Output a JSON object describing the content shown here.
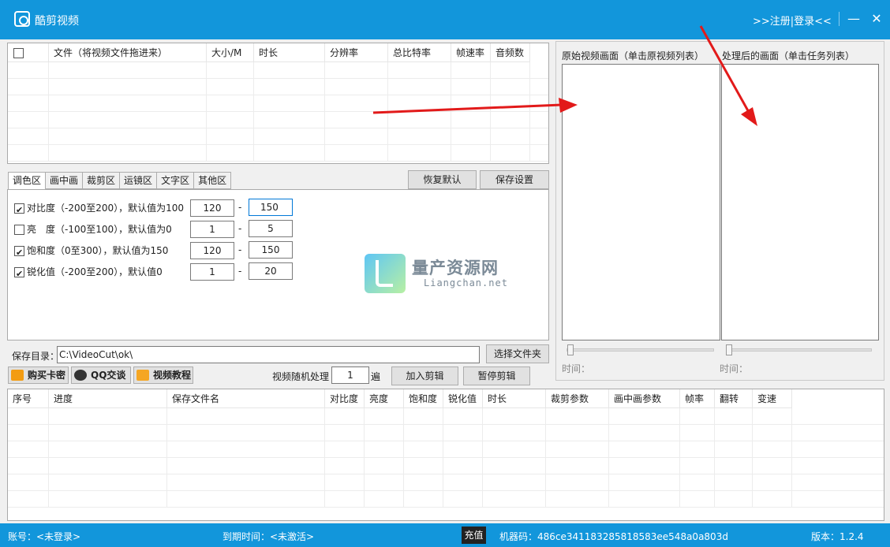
{
  "titlebar": {
    "title": "酷剪视频",
    "register_login": ">>注册|登录<<",
    "minimize": "—",
    "close": "✕"
  },
  "file_table": {
    "columns": [
      "文件（将视频文件拖进来）",
      "大小/M",
      "时长",
      "分辨率",
      "总比特率",
      "帧速率",
      "音频数"
    ]
  },
  "tabs": [
    "调色区",
    "画中画",
    "裁剪区",
    "运镜区",
    "文字区",
    "其他区"
  ],
  "buttons": {
    "restore_default": "恢复默认",
    "save_settings": "保存设置",
    "choose_folder": "选择文件夹",
    "buy_card": "购买卡密",
    "qq_chat": "QQ交谈",
    "video_tutorial": "视频教程",
    "add_edit": "加入剪辑",
    "pause_edit": "暂停剪辑"
  },
  "color_settings": [
    {
      "label": "对比度（-200至200），默认值为100",
      "checked": true,
      "min": "120",
      "max": "150"
    },
    {
      "label": "亮　度（-100至100），默认值为0",
      "checked": false,
      "min": "1",
      "max": "5"
    },
    {
      "label": "饱和度（0至300），默认值为150",
      "checked": true,
      "min": "120",
      "max": "150"
    },
    {
      "label": "锐化值（-200至200），默认值0",
      "checked": true,
      "min": "1",
      "max": "20"
    }
  ],
  "dash": "-",
  "watermark": {
    "title": "量产资源网",
    "sub": "Liangchan.net"
  },
  "save_dir": {
    "label": "保存目录：",
    "value": "C:\\VideoCut\\ok\\"
  },
  "random": {
    "label": "视频随机处理",
    "value": "1",
    "unit": "遍"
  },
  "preview": {
    "original_label": "原始视频画面（单击原视频列表）",
    "processed_label": "处理后的画面（单击任务列表）",
    "time_label": "时间："
  },
  "task_table": {
    "columns": [
      "序号",
      "进度",
      "保存文件名",
      "对比度",
      "亮度",
      "饱和度",
      "锐化值",
      "时长",
      "裁剪参数",
      "画中画参数",
      "帧率",
      "翻转",
      "变速"
    ]
  },
  "footer": {
    "account": "账号：<未登录>",
    "expire": "到期时间：<未激活>",
    "recharge": "充值",
    "machine_code": "机器码：486ce341183285818583ee548a0a803d",
    "version": "版本：1.2.4"
  },
  "colors": {
    "titlebar": "#1296db",
    "arrow": "#e21a1a"
  }
}
